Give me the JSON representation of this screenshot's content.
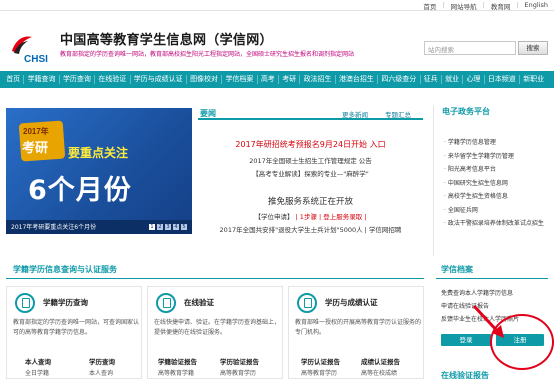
{
  "topbar": {
    "links": [
      "首页",
      "网站导航",
      "教育网",
      "English"
    ]
  },
  "header": {
    "title": "中国高等教育学生信息网（学信网）",
    "logo_text": "CHSI",
    "desc": "教育部指定的学历查询唯一网站，教育部高校招生阳光工程指定网站，全国硕士研究生招生报名和调剂指定网站",
    "search_placeholder": "站内搜索",
    "search_button": "搜索"
  },
  "nav": [
    "首页",
    "学籍查询",
    "学历查询",
    "在线验证",
    "学历与成绩认证",
    "图像校对",
    "学信档案",
    "高考",
    "考研",
    "政法招生",
    "港澳台招生",
    "四六级查分",
    "征兵",
    "就业",
    "心理",
    "日本频道",
    "新职业"
  ],
  "banner": {
    "badge_year": "2017年",
    "badge_word": "考研",
    "focus_text": "要重点关注",
    "big_text": "6个月份",
    "caption": "2017年考研要重点关注6个月份",
    "pages": [
      "1",
      "2",
      "3",
      "4",
      "5"
    ]
  },
  "news": {
    "title": "要闻",
    "more1": "更多新闻",
    "more2": "专题汇总",
    "headline": "2017年研招统考预报名9月24日开始",
    "headline_link": "入口",
    "lines": [
      "2017年全国硕士生招生工作管理规定 公告",
      "【高考专业解读】探索的专业—\"麻醉学\""
    ],
    "section2": "推免服务系统正在开放",
    "section2_tag": "【学位申请】",
    "section2_links": "| 1步骤 | 登上服务录取 |",
    "section2_line2": "2017年全国共安排\"退役大学生士兵计划\"5000人 | 学信网招聘"
  },
  "sidebar": {
    "title": "电子政务平台",
    "items": [
      "学籍学历信息管理",
      "来华留学生学籍学历管理",
      "阳光高考信息平台",
      "中国研究生招生信息网",
      "高校学生招生资格信息",
      "全国征兵网",
      "政法干警招录培养体制改革试点招生"
    ]
  },
  "section": {
    "title": "学籍学历信息查询与认证服务",
    "cards": [
      {
        "title": "学籍学历查询",
        "desc": "教育部指定的学历查询唯一网站，可查询国家认可的高等教育学籍学历信息。",
        "row1": [
          "本人查询",
          "学历查询"
        ],
        "row2": [
          "全日学籍",
          "本人查询"
        ]
      },
      {
        "title": "在线验证",
        "desc": "在线快捷申请、验证。在学籍学历查询基础上，提供便捷的在线验证服务。",
        "row1": [
          "学籍验证报告",
          "学历验证报告"
        ],
        "row2": [
          "高等教育学籍",
          "高等教育学历"
        ]
      },
      {
        "title": "学历与成绩认证",
        "desc": "教育部唯一授权的开展高等教育学历认证服务的专门机构。",
        "row1": [
          "学历认证报告",
          "成绩认证报告"
        ],
        "row2": [
          "高等教育学历",
          "高等在校成绩"
        ]
      }
    ]
  },
  "xuexin": {
    "title": "学信档案",
    "items": [
      "免费查询本人学籍学历信息",
      "申请在线验证报告",
      "反馈毕业生在校本人学历照片"
    ],
    "login": "登录",
    "register": "注册",
    "verify_title": "在线验证报告"
  },
  "colors": {
    "accent": "#0f9aa8",
    "headline": "#d4000c",
    "desc": "#c0007a",
    "brand": "#0068b7",
    "annotation": "#e3001b"
  }
}
